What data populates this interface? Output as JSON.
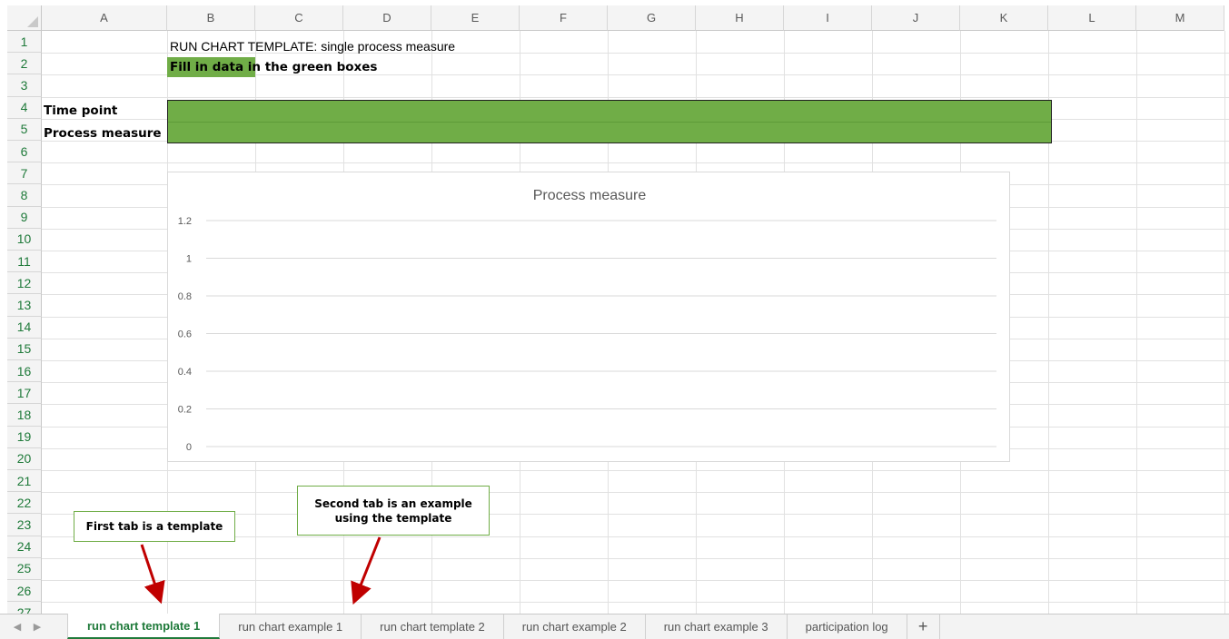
{
  "columns": [
    "A",
    "B",
    "C",
    "D",
    "E",
    "F",
    "G",
    "H",
    "I",
    "J",
    "K",
    "L",
    "M"
  ],
  "rows": [
    "1",
    "2",
    "3",
    "4",
    "5",
    "6",
    "7",
    "8",
    "9",
    "10",
    "11",
    "12",
    "13",
    "14",
    "15",
    "16",
    "17",
    "18",
    "19",
    "20",
    "21",
    "22",
    "23",
    "24",
    "25",
    "26",
    "27"
  ],
  "cells": {
    "b1": "RUN CHART TEMPLATE: single process measure",
    "b2_highlight": "Fill in data in",
    "b2_rest": " the green boxes",
    "a4": "Time point",
    "a5": "Process measure"
  },
  "colors": {
    "input_green": "#70ad47",
    "accent": "#1f7a3a",
    "arrow": "#c00000"
  },
  "chart_data": {
    "type": "line",
    "title": "Process measure",
    "series": [],
    "y_ticks": [
      "1.2",
      "1",
      "0.8",
      "0.6",
      "0.4",
      "0.2",
      "0"
    ],
    "ylim": [
      0,
      1.2
    ],
    "grid": true
  },
  "callouts": {
    "first": "First tab is a template",
    "second": "Second tab is an example using the template"
  },
  "tabs": [
    {
      "label": "run chart template 1",
      "active": true
    },
    {
      "label": "run chart example 1",
      "active": false
    },
    {
      "label": "run chart template 2",
      "active": false
    },
    {
      "label": "run chart example 2",
      "active": false
    },
    {
      "label": "run chart example 3",
      "active": false
    },
    {
      "label": "participation log",
      "active": false
    }
  ],
  "add_tab_label": "+",
  "icons": {
    "prev": "triangle-left-icon",
    "next": "triangle-right-icon"
  }
}
